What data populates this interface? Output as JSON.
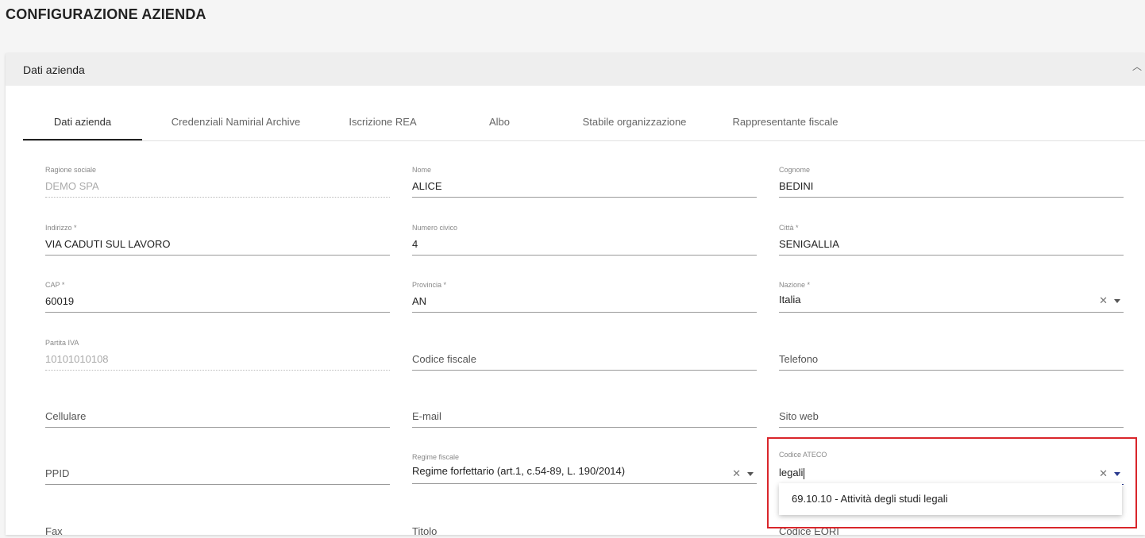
{
  "page_title": "CONFIGURAZIONE AZIENDA",
  "panel": {
    "title": "Dati azienda",
    "collapse_icon": "chevron-up-icon"
  },
  "tabs": [
    {
      "label": "Dati azienda",
      "active": true
    },
    {
      "label": "Credenziali Namirial Archive"
    },
    {
      "label": "Iscrizione REA"
    },
    {
      "label": "Albo"
    },
    {
      "label": "Stabile organizzazione"
    },
    {
      "label": "Rappresentante fiscale"
    }
  ],
  "fields": {
    "ragione_sociale": {
      "label": "Ragione sociale",
      "value": "DEMO SPA"
    },
    "nome": {
      "label": "Nome",
      "value": "ALICE"
    },
    "cognome": {
      "label": "Cognome",
      "value": "BEDINI"
    },
    "indirizzo": {
      "label": "Indirizzo *",
      "value": "VIA CADUTI SUL LAVORO"
    },
    "numero_civico": {
      "label": "Numero civico",
      "value": "4"
    },
    "citta": {
      "label": "Città *",
      "value": "SENIGALLIA"
    },
    "cap": {
      "label": "CAP *",
      "value": "60019"
    },
    "provincia": {
      "label": "Provincia *",
      "value": "AN"
    },
    "nazione": {
      "label": "Nazione *",
      "value": "Italia"
    },
    "partita_iva": {
      "label": "Partita IVA",
      "value": "10101010108"
    },
    "codice_fiscale": {
      "placeholder": "Codice fiscale"
    },
    "telefono": {
      "placeholder": "Telefono"
    },
    "cellulare": {
      "placeholder": "Cellulare"
    },
    "email": {
      "placeholder": "E-mail"
    },
    "sito_web": {
      "placeholder": "Sito web"
    },
    "ppid": {
      "placeholder": "PPID"
    },
    "regime_fiscale": {
      "label": "Regime fiscale",
      "value": "Regime forfettario (art.1, c.54-89, L. 190/2014)"
    },
    "codice_ateco": {
      "label": "Codice ATECO",
      "value": "legali"
    },
    "fax": {
      "placeholder": "Fax"
    },
    "titolo": {
      "placeholder": "Titolo"
    },
    "codice_eori": {
      "placeholder": "Codice EORI"
    }
  },
  "ateco_dropdown": {
    "options": [
      "69.10.10 - Attività degli studi legali"
    ]
  },
  "colors": {
    "highlight": "#d9262b",
    "focus_accent": "#2a3a8f"
  }
}
